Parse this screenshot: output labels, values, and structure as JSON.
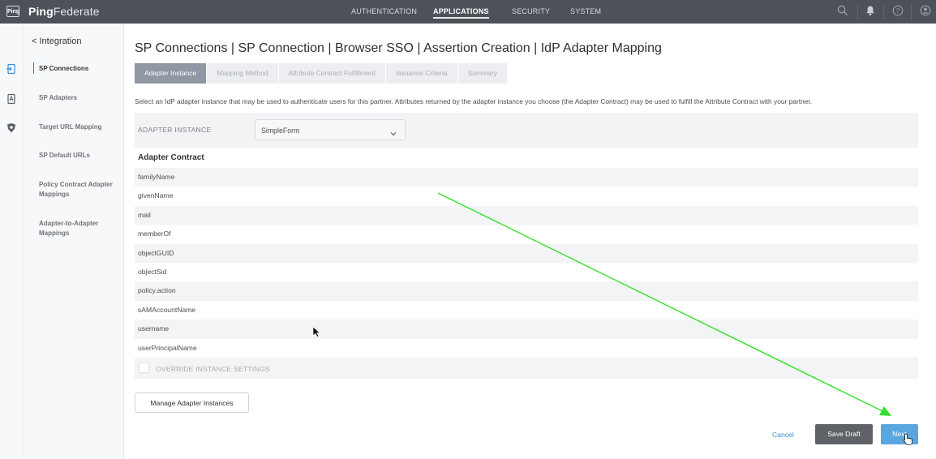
{
  "topbar": {
    "logo_text": "Ping",
    "brand_bold": "Ping",
    "brand_light": "Federate",
    "nav": [
      "AUTHENTICATION",
      "APPLICATIONS",
      "SECURITY",
      "SYSTEM"
    ],
    "active_nav": "APPLICATIONS"
  },
  "sidenav": {
    "back": "< Integration",
    "items": [
      "SP Connections",
      "SP Adapters",
      "Target URL Mapping",
      "SP Default URLs",
      "Policy Contract Adapter Mappings",
      "Adapter-to-Adapter Mappings"
    ],
    "active": "SP Connections"
  },
  "main": {
    "breadcrumb": "SP Connections | SP Connection | Browser SSO | Assertion Creation | IdP Adapter Mapping",
    "tabs": [
      "Adapter Instance",
      "Mapping Method",
      "Attribute Contract Fulfillment",
      "Issuance Criteria",
      "Summary"
    ],
    "active_tab": "Adapter Instance",
    "description": "Select an IdP adapter instance that may be used to authenticate users for this partner. Attributes returned by the adapter instance you choose (the Adapter Contract) may be used to fulfill the Attribute Contract with your partner.",
    "adapter_instance_label": "ADAPTER INSTANCE",
    "adapter_instance_value": "SimpleForm",
    "contract_title": "Adapter Contract",
    "contract": [
      "familyName",
      "givenName",
      "mail",
      "memberOf",
      "objectGUID",
      "objectSid",
      "policy.action",
      "sAMAccountName",
      "username",
      "userPrincipalName"
    ],
    "override_label": "OVERRIDE INSTANCE SETTINGS",
    "override_checked": false,
    "manage_button": "Manage Adapter Instances"
  },
  "footer": {
    "cancel": "Cancel",
    "save_draft": "Save Draft",
    "next": "Next"
  },
  "colors": {
    "topbar": "#4d5159",
    "active_tab": "#8f98a3",
    "next_button": "#5aa7e0",
    "save_draft": "#5f6368",
    "annotation_arrow": "#33e02a"
  }
}
